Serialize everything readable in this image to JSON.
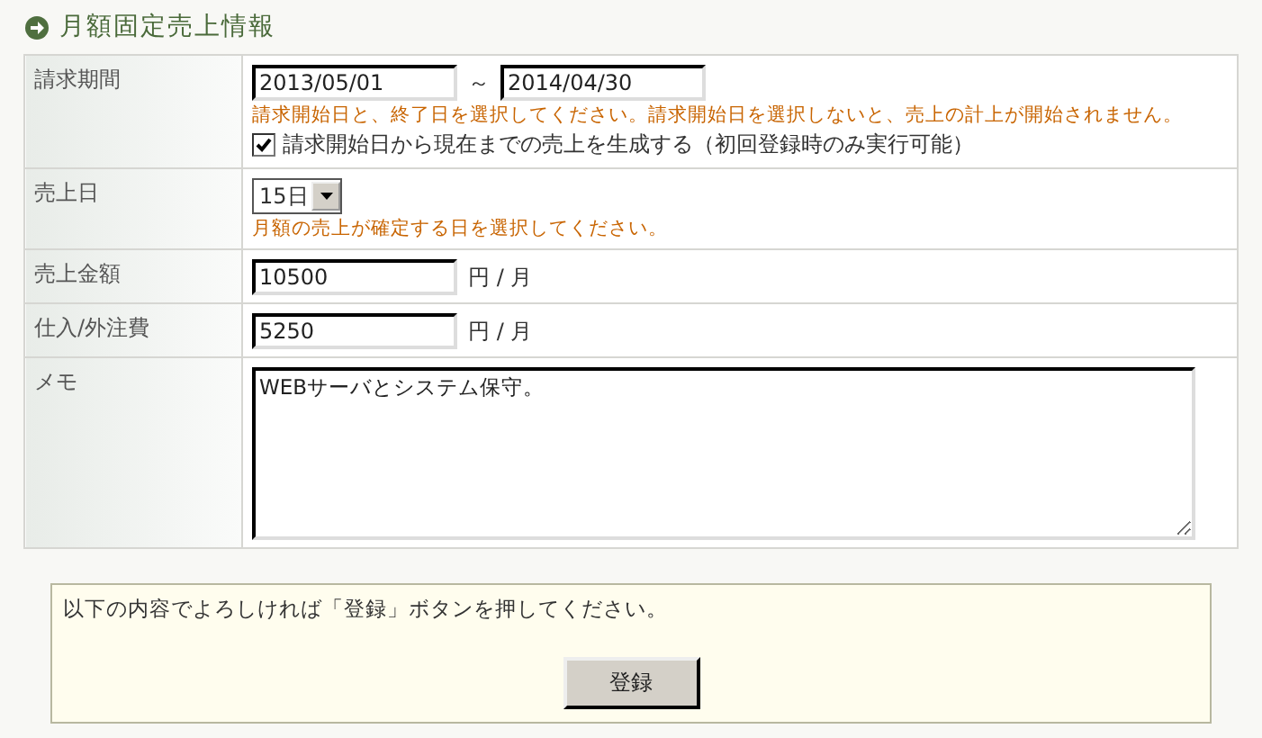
{
  "heading": "月額固定売上情報",
  "rows": [
    {
      "kind": "period",
      "label": "請求期間",
      "start": "2013/05/01",
      "separator": "～",
      "end": "2014/04/30",
      "note": "請求開始日と、終了日を選択してください。請求開始日を選択しないと、売上の計上が開始されません。",
      "checkbox": {
        "label": "請求開始日から現在までの売上を生成する（初回登録時のみ実行可能）",
        "checked": true
      }
    },
    {
      "kind": "select",
      "label": "売上日",
      "value": "15日",
      "note": "月額の売上が確定する日を選択してください。"
    },
    {
      "kind": "amount",
      "label": "売上金額",
      "value": "10500",
      "unit": "円 / 月"
    },
    {
      "kind": "amount",
      "label": "仕入/外注費",
      "value": "5250",
      "unit": "円 / 月"
    },
    {
      "kind": "memo",
      "label": "メモ",
      "value": "WEBサーバとシステム保守。"
    }
  ],
  "notice": {
    "message": "以下の内容でよろしければ「登録」ボタンを押してください。",
    "button": "登録"
  }
}
